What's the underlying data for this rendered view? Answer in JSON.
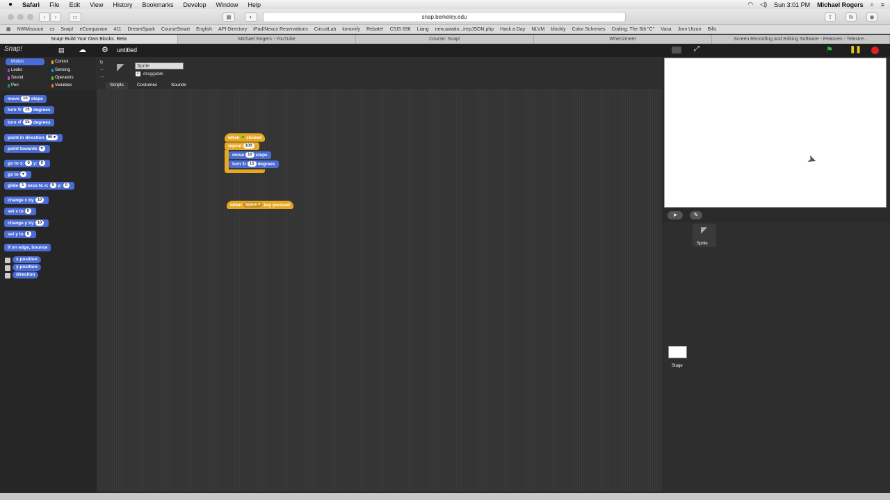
{
  "menubar": {
    "app": "Safari",
    "items": [
      "File",
      "Edit",
      "View",
      "History",
      "Bookmarks",
      "Develop",
      "Window",
      "Help"
    ],
    "clock": "Sun 3:01 PM",
    "user": "Michael Rogers"
  },
  "browser": {
    "url": "snap.berkeley.edu",
    "bookmarks": [
      "NWMissouri",
      "cs",
      "Snap!",
      "eCompanion",
      "411",
      "DreamSpark",
      "CourseSmart",
      "English",
      "API Directory",
      "iPad/Nexus Reservations",
      "CircuitLab",
      "kimonify",
      "Rebate!",
      "CSIS 696",
      "Liang",
      "new.aviatio...irepJSON.php",
      "Hack a Day",
      "NLVM",
      "blockly",
      "Color Schemes",
      "Coding: The 5th \"C\"",
      "Vasa",
      "Jorn Utzon",
      "Bills"
    ],
    "tabs": [
      "Snap! Build Your Own Blocks. Beta",
      "Michael Rogers - YouTube",
      "Course: Snap!",
      "When2meet",
      "Screen Recording and Editing Software - Features - Telestre..."
    ]
  },
  "snap": {
    "logo": "Snap!",
    "project": "untitled",
    "categories": [
      "Motion",
      "Looks",
      "Sound",
      "Pen",
      "Control",
      "Sensing",
      "Operators",
      "Variables"
    ],
    "category_colors": [
      "#4a6cd4",
      "#8a55d7",
      "#cf4ad9",
      "#0e9a6c",
      "#e6a822",
      "#04a0d8",
      "#62c213",
      "#f3761d"
    ],
    "sprite": {
      "name": "Sprite",
      "draggable": "draggable"
    },
    "tabs": [
      "Scripts",
      "Costumes",
      "Sounds"
    ],
    "palette": {
      "move": [
        "move",
        "10",
        "steps"
      ],
      "turn_cw": [
        "turn ↻",
        "15",
        "degrees"
      ],
      "turn_ccw": [
        "turn ↺",
        "15",
        "degrees"
      ],
      "point_dir": [
        "point in direction",
        "90 ▾"
      ],
      "point_towards": [
        "point towards",
        "▾"
      ],
      "goto_xy": [
        "go to x:",
        "0",
        "y:",
        "0"
      ],
      "goto": [
        "go to",
        "▾"
      ],
      "glide": [
        "glide",
        "1",
        "secs to x:",
        "0",
        "y:",
        "0"
      ],
      "change_x": [
        "change x by",
        "10"
      ],
      "set_x": [
        "set x to",
        "0"
      ],
      "change_y": [
        "change y by",
        "10"
      ],
      "set_y": [
        "set y to",
        "0"
      ],
      "bounce": "if on edge, bounce",
      "reporters": [
        "x position",
        "y position",
        "direction"
      ]
    },
    "script": {
      "hat": [
        "when",
        "⚑",
        "clicked"
      ],
      "repeat": [
        "repeat",
        "100"
      ],
      "move": [
        "move",
        "10",
        "steps"
      ],
      "turn": [
        "turn ↻",
        "15",
        "degrees"
      ],
      "key_hat": [
        "when",
        "space ▾",
        "key pressed"
      ]
    },
    "corral": {
      "sprite": "Sprite",
      "stage": "Stage"
    }
  }
}
